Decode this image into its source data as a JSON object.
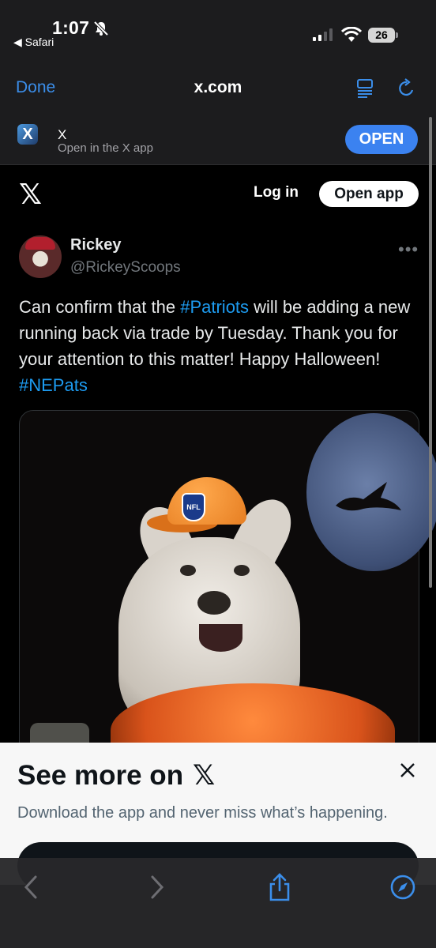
{
  "status_bar": {
    "time": "1:07",
    "back_label": "◀ Safari",
    "battery": "26"
  },
  "safari_nav": {
    "done_label": "Done",
    "url": "x.com"
  },
  "smart_banner": {
    "app_name": "X",
    "subtitle": "Open in the X app",
    "open_label": "OPEN",
    "logo_glyph": "X"
  },
  "x_header": {
    "logo": "𝕏",
    "login_label": "Log in",
    "open_app_label": "Open app"
  },
  "post": {
    "author_name": "Rickey",
    "author_handle": "@RickeyScoops",
    "more": "•••",
    "text_parts": {
      "p1": "Can confirm that the ",
      "tag1": "#Patriots",
      "p2": " will be adding a new running back via trade by Tuesday. Thank you for your attention to this matter! Happy Halloween! ",
      "tag2": "#NEPats"
    },
    "media": {
      "cap_logo_text": "NFL"
    }
  },
  "see_more_sheet": {
    "title": "See more on",
    "title_logo": "𝕏",
    "description": "Download the app and never miss what’s happening."
  },
  "colors": {
    "link": "#1d9bf0",
    "safari_blue": "#3b8eea",
    "open_button": "#3b82f0"
  }
}
